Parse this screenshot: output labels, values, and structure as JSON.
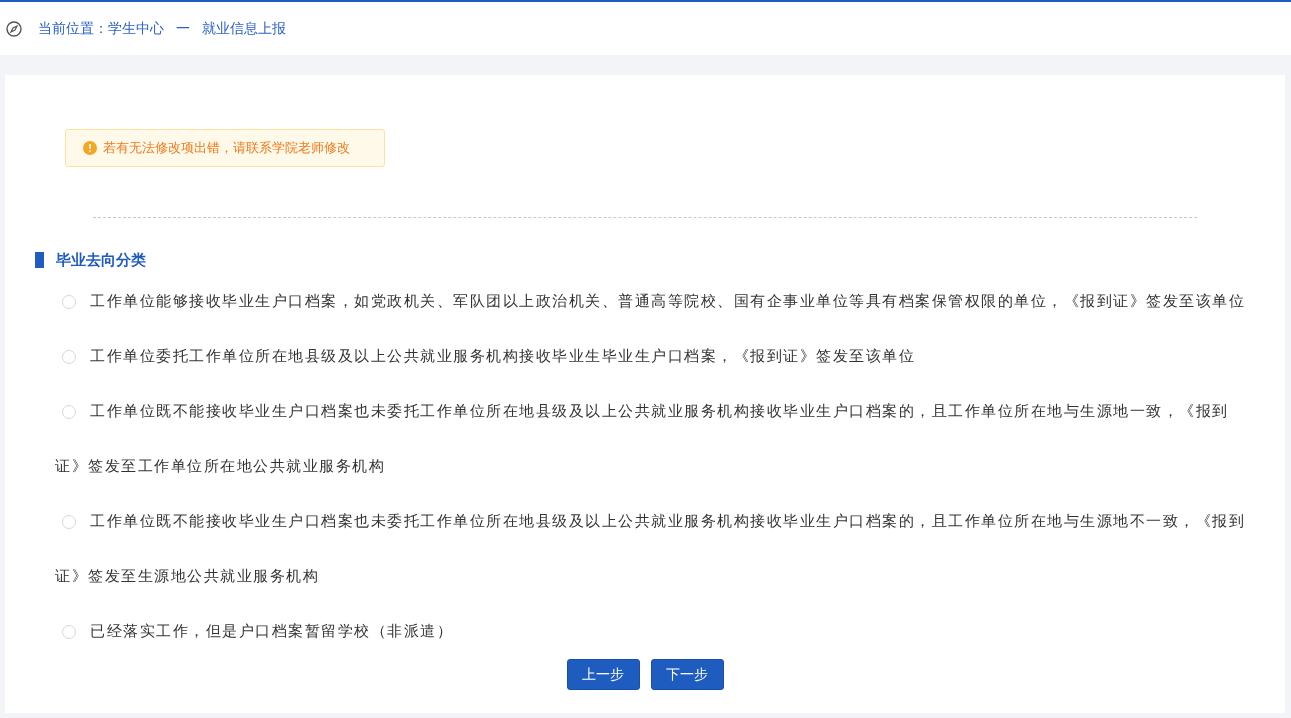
{
  "breadcrumb": {
    "current_location": "当前位置：学生中心",
    "separator": "一",
    "page": "就业信息上报"
  },
  "notice": "若有无法修改项出错，请联系学院老师修改",
  "section_title": "毕业去向分类",
  "options": [
    {
      "label": "工作单位能够接收毕业生户口档案，如党政机关、军队团以上政治机关、普通高等院校、国有企事业单位等具有档案保管权限的单位，《报到证》签发至该单位",
      "selected": false
    },
    {
      "label": "工作单位委托工作单位所在地县级及以上公共就业服务机构接收毕业生毕业生户口档案，《报到证》签发至该单位",
      "selected": false
    },
    {
      "label": "工作单位既不能接收毕业生户口档案也未委托工作单位所在地县级及以上公共就业服务机构接收毕业生户口档案的，且工作单位所在地与生源地一致，《报到证》签发至工作单位所在地公共就业服务机构",
      "selected": false
    },
    {
      "label": "工作单位既不能接收毕业生户口档案也未委托工作单位所在地县级及以上公共就业服务机构接收毕业生户口档案的，且工作单位所在地与生源地不一致，《报到证》签发至生源地公共就业服务机构",
      "selected": false
    },
    {
      "label": "已经落实工作，但是户口档案暂留学校（非派遣）",
      "selected": false
    }
  ],
  "buttons": [
    "上一步",
    "下一步"
  ]
}
